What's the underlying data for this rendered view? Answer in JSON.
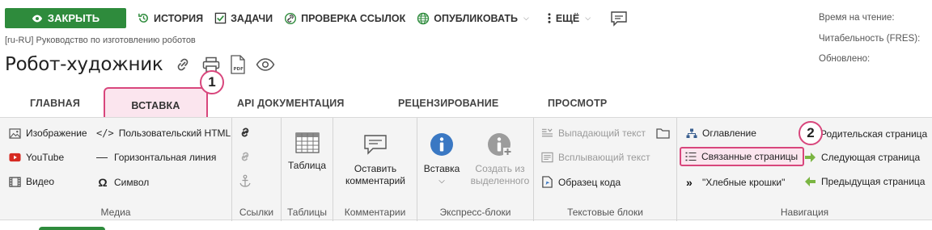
{
  "toolbar": {
    "close_label": "ЗАКРЫТЬ",
    "history_label": "ИСТОРИЯ",
    "tasks_label": "ЗАДАЧИ",
    "linkcheck_label": "ПРОВЕРКА ССЫЛОК",
    "publish_label": "ОПУБЛИКОВАТЬ",
    "more_label": "ЕЩЁ"
  },
  "meta": {
    "reading_time": "Время на чтение:",
    "readability": "Читабельность (FRES):",
    "updated": "Обновлено:"
  },
  "breadcrumb": "[ru-RU] Руководство по изготовлению роботов",
  "page_title": "Робот-художник",
  "tabs": [
    {
      "label": "ГЛАВНАЯ"
    },
    {
      "label": "ВСТАВКА"
    },
    {
      "label": "API ДОКУМЕНТАЦИЯ"
    },
    {
      "label": "РЕЦЕНЗИРОВАНИЕ"
    },
    {
      "label": "ПРОСМОТР"
    }
  ],
  "callouts": [
    "1",
    "2"
  ],
  "ribbon": {
    "media": {
      "label": "Медиа",
      "image": "Изображение",
      "youtube": "YouTube",
      "video": "Видео",
      "custom_html": "Пользовательский HTML",
      "hr": "Горизонтальная линия",
      "symbol": "Символ"
    },
    "links": {
      "label": "Ссылки"
    },
    "tables": {
      "label": "Таблицы",
      "table": "Таблица"
    },
    "comments": {
      "label": "Комментарии",
      "leave_line1": "Оставить",
      "leave_line2": "комментарий"
    },
    "express": {
      "label": "Экспресс-блоки",
      "insert": "Вставка",
      "create_line1": "Создать из",
      "create_line2": "выделенного"
    },
    "text_blocks": {
      "label": "Текстовые блоки",
      "dropdown": "Выпадающий текст",
      "popup": "Всплывающий текст",
      "code": "Образец кода"
    },
    "navigation": {
      "label": "Навигация",
      "toc": "Оглавление",
      "related": "Связанные страницы",
      "breadcrumbs": "\"Хлебные крошки\"",
      "parent": "Родительская страница",
      "next": "Следующая страница",
      "prev": "Предыдущая страница"
    }
  },
  "colors": {
    "accent_green": "#2e8b3c",
    "highlight_pink": "#d8467c",
    "info_blue": "#3a78c3"
  }
}
